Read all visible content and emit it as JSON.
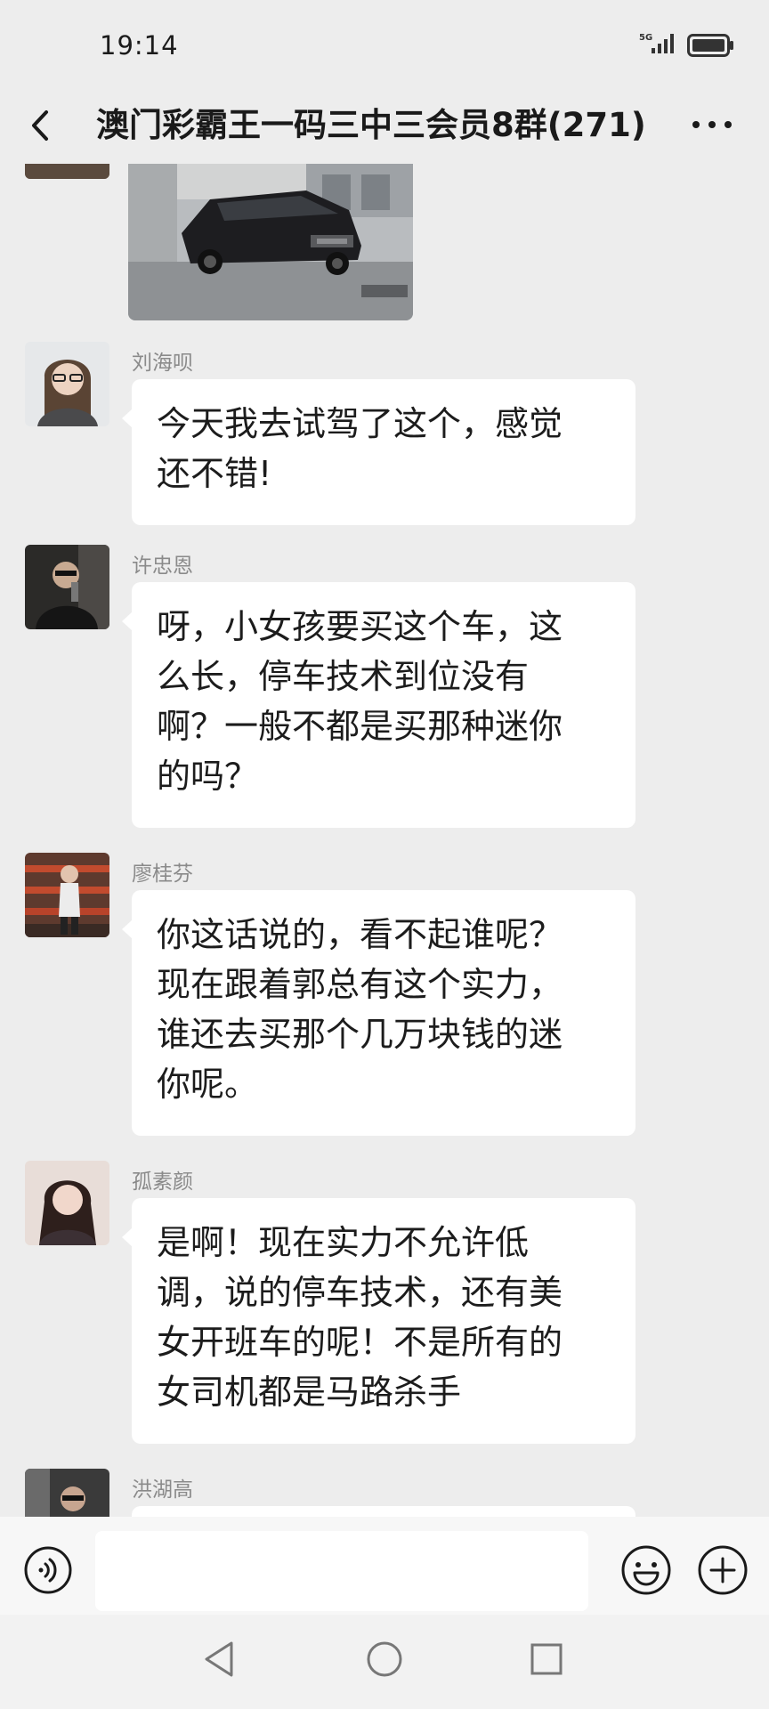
{
  "status_bar": {
    "time": "19:14",
    "network": "5G"
  },
  "header": {
    "title": "澳门彩霸王一码三中三会员8群(271)"
  },
  "messages": [
    {
      "sender": "刘海呗",
      "lines": [
        "今天我去试驾了这个，感觉",
        "还不错!"
      ]
    },
    {
      "sender": "许忠恩",
      "lines": [
        "呀，小女孩要买这个车，这",
        "么长，停车技术到位没有",
        "啊？一般不都是买那种迷你",
        "的吗？"
      ]
    },
    {
      "sender": "廖桂芬",
      "lines": [
        "你这话说的，看不起谁呢？",
        "现在跟着郭总有这个实力，",
        "谁还去买那个几万块钱的迷",
        "你呢。"
      ]
    },
    {
      "sender": "孤素颜",
      "lines": [
        "是啊！现在实力不允许低",
        "调，说的停车技术，还有美",
        "女开班车的呢！不是所有的",
        "女司机都是马路杀手"
      ]
    },
    {
      "sender": "洪湖高",
      "lines": []
    }
  ],
  "colors": {
    "background": "#ededed",
    "bubble": "#ffffff",
    "name_text": "#8a8a8a"
  },
  "icons": {
    "header": [
      "back-arrow-icon",
      "more-icon"
    ],
    "input": [
      "voice-icon",
      "emoji-icon",
      "plus-icon"
    ],
    "nav": [
      "nav-back-icon",
      "nav-home-icon",
      "nav-recent-icon"
    ]
  }
}
